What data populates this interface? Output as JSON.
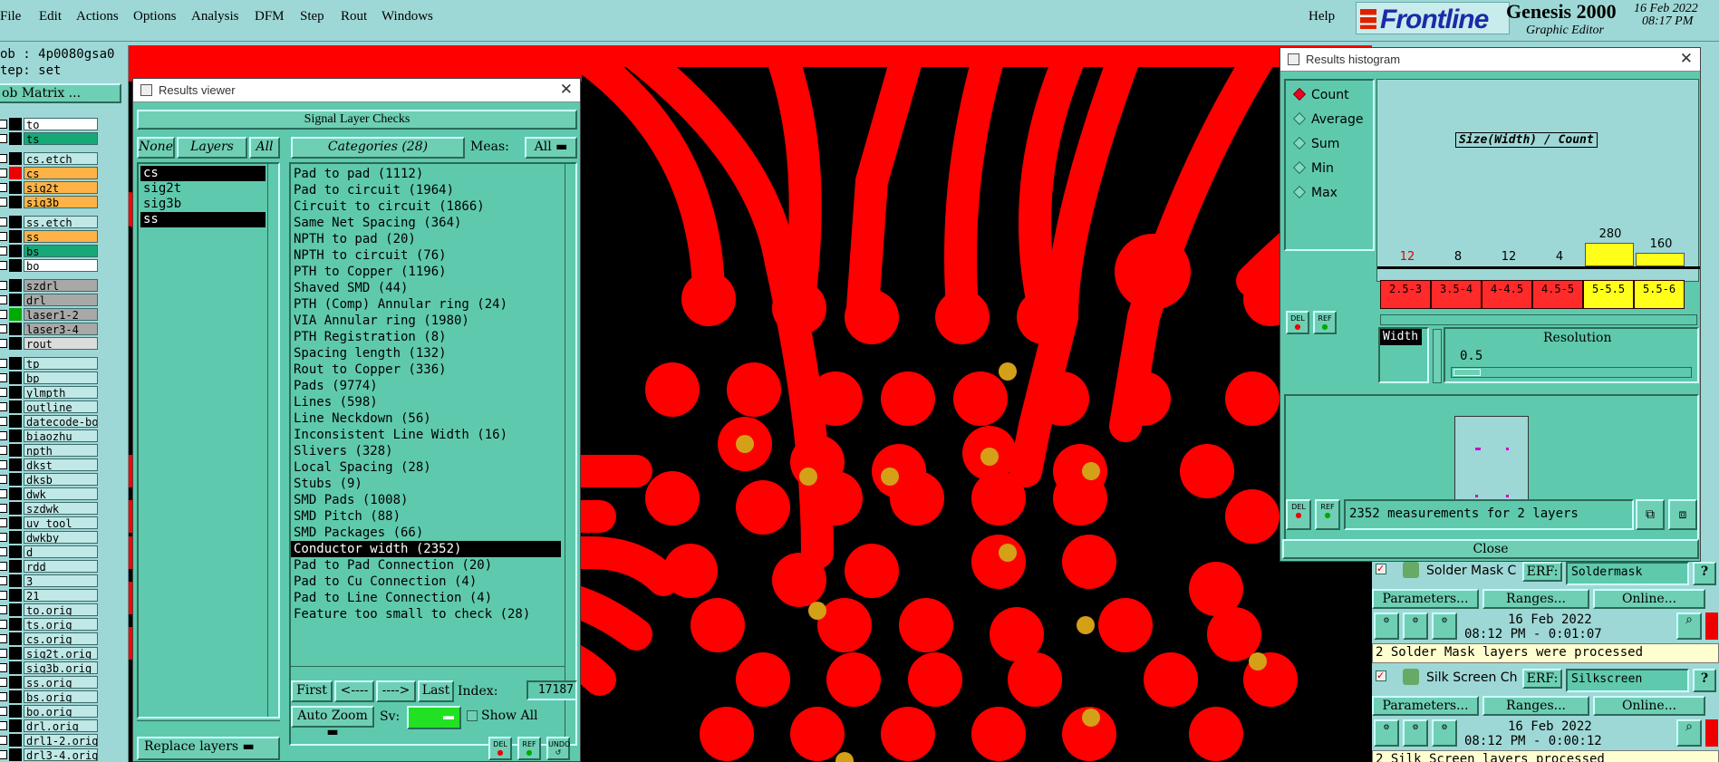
{
  "app": {
    "product": "Genesis 2000",
    "subtitle": "Graphic Editor",
    "brand": "Frontline",
    "date": "16 Feb 2022",
    "time": "08:17 PM"
  },
  "menu": {
    "items": [
      "File",
      "Edit",
      "Actions",
      "Options",
      "Analysis",
      "DFM",
      "Step",
      "Rout",
      "Windows"
    ],
    "help": "Help"
  },
  "job": {
    "job_label": "ob : 4p0080gsa0",
    "step_label": "tep: set",
    "matrix_button": "ob Matrix ..."
  },
  "layers": [
    {
      "name": "to",
      "color": "#ffffff"
    },
    {
      "name": "ts",
      "color": "#18a878"
    },
    {
      "name": "cs.etch",
      "color": "#bfe8e6"
    },
    {
      "name": "cs",
      "color": "#ffb347"
    },
    {
      "name": "sig2t",
      "color": "#ffb347"
    },
    {
      "name": "sig3b",
      "color": "#ffb347"
    },
    {
      "name": "ss.etch",
      "color": "#bfe8e6"
    },
    {
      "name": "ss",
      "color": "#ffb347"
    },
    {
      "name": "bs",
      "color": "#18a878"
    },
    {
      "name": "bo",
      "color": "#ffffff"
    },
    {
      "name": "szdrl",
      "color": "#a8a8a8"
    },
    {
      "name": "drl",
      "color": "#a8a8a8"
    },
    {
      "name": "laser1-2",
      "color": "#a8a8a8"
    },
    {
      "name": "laser3-4",
      "color": "#a8a8a8"
    },
    {
      "name": "rout",
      "color": "#dcdcdc"
    },
    {
      "name": "tp",
      "color": "#bfe8e6"
    },
    {
      "name": "bp",
      "color": "#bfe8e6"
    },
    {
      "name": "ylmpth",
      "color": "#bfe8e6"
    },
    {
      "name": "outline",
      "color": "#bfe8e6"
    },
    {
      "name": "datecode-bo",
      "color": "#bfe8e6"
    },
    {
      "name": "biaozhu",
      "color": "#bfe8e6"
    },
    {
      "name": "npth",
      "color": "#bfe8e6"
    },
    {
      "name": "dkst",
      "color": "#bfe8e6"
    },
    {
      "name": "dksb",
      "color": "#bfe8e6"
    },
    {
      "name": "dwk",
      "color": "#bfe8e6"
    },
    {
      "name": "szdwk",
      "color": "#bfe8e6"
    },
    {
      "name": "uv_tool",
      "color": "#bfe8e6"
    },
    {
      "name": "dwkby",
      "color": "#bfe8e6"
    },
    {
      "name": "d",
      "color": "#bfe8e6"
    },
    {
      "name": "rdd",
      "color": "#bfe8e6"
    },
    {
      "name": "3",
      "color": "#bfe8e6"
    },
    {
      "name": "21",
      "color": "#bfe8e6"
    },
    {
      "name": "to.orig",
      "color": "#bfe8e6"
    },
    {
      "name": "ts.orig",
      "color": "#bfe8e6"
    },
    {
      "name": "cs.orig",
      "color": "#bfe8e6"
    },
    {
      "name": "sig2t.orig",
      "color": "#bfe8e6"
    },
    {
      "name": "sig3b.orig",
      "color": "#bfe8e6"
    },
    {
      "name": "ss.orig",
      "color": "#bfe8e6"
    },
    {
      "name": "bs.orig",
      "color": "#bfe8e6"
    },
    {
      "name": "bo.orig",
      "color": "#bfe8e6"
    },
    {
      "name": "drl.orig",
      "color": "#bfe8e6"
    },
    {
      "name": "drl1-2.orig",
      "color": "#bfe8e6"
    },
    {
      "name": "drl3-4.orig",
      "color": "#bfe8e6"
    }
  ],
  "results_viewer": {
    "title": "Results viewer",
    "header": "Signal Layer Checks",
    "none_button": "None",
    "layers_button": "Layers",
    "all_button": "All",
    "categories_button": "Categories (28)",
    "meas_label": "Meas:",
    "meas_value": "All",
    "layer_list": [
      "cs",
      "sig2t",
      "sig3b",
      "ss"
    ],
    "selected_layers": [
      "cs",
      "ss"
    ],
    "categories": [
      "Pad to pad (1112)",
      "Pad to circuit (1964)",
      "Circuit to circuit (1866)",
      "Same Net Spacing (364)",
      "NPTH to pad (20)",
      "NPTH to circuit (76)",
      "PTH to Copper (1196)",
      "Shaved SMD (44)",
      "PTH (Comp) Annular ring (24)",
      "VIA Annular ring (1980)",
      "PTH Registration (8)",
      "Spacing length (132)",
      "Rout to Copper (336)",
      "Pads (9774)",
      "Lines (598)",
      "Line Neckdown (56)",
      "Inconsistent Line Width (16)",
      "Slivers (328)",
      "Local Spacing (28)",
      "Stubs (9)",
      "SMD Pads (1008)",
      "SMD Pitch (88)",
      "SMD Packages (66)",
      "Conductor width (2352)",
      "Pad to Pad Connection (20)",
      "Pad to Cu Connection (4)",
      "Pad to Line Connection (4)",
      "Feature too small to check (28)"
    ],
    "selected_category": "Conductor width (2352)",
    "first_button": "First",
    "prev_button": "<----",
    "next_button": "---->",
    "last_button": "Last",
    "index_label": "Index:",
    "index_value": "17187",
    "auto_zoom_button": "Auto Zoom",
    "sv_label": "Sv:",
    "show_all_label": "Show All",
    "replace_layers_button": "Replace layers",
    "del_label": "DEL",
    "ref_label": "REF",
    "undo_label": "UNDO"
  },
  "histogram": {
    "title": "Results histogram",
    "modes": [
      "Count",
      "Average",
      "Sum",
      "Min",
      "Max"
    ],
    "selected_mode": "Count",
    "chart_title": "Size(Width) / Count",
    "bins": [
      {
        "range": "2.5-3",
        "count": 12,
        "color": "#ff2a2a",
        "countColor": "#e00000"
      },
      {
        "range": "3.5-4",
        "count": 8,
        "color": "#ff2a2a",
        "countColor": "#000000"
      },
      {
        "range": "4-4.5",
        "count": 12,
        "color": "#ff2a2a",
        "countColor": "#000000"
      },
      {
        "range": "4.5-5",
        "count": 4,
        "color": "#ff2a2a",
        "countColor": "#000000"
      },
      {
        "range": "5-5.5",
        "count": 280,
        "color": "#ffff1a",
        "countColor": "#000000"
      },
      {
        "range": "5.5-6",
        "count": 160,
        "color": "#ffff1a",
        "countColor": "#000000"
      }
    ],
    "field_label": "Width",
    "resolution_label": "Resolution",
    "resolution_value": "0.5",
    "status": "2352 measurements for 2 layers",
    "close_button": "Close",
    "del_label": "DEL",
    "ref_label": "REF"
  },
  "checks": [
    {
      "name": "Solder Mask Ch",
      "erf_label": "ERF:",
      "erf_value": "Soldermask",
      "help": "?",
      "parameters_button": "Parameters...",
      "ranges_button": "Ranges...",
      "online_button": "Online...",
      "date": "16 Feb 2022",
      "time": "08:12 PM - 0:01:07",
      "status": "2 Solder Mask layers were processed"
    },
    {
      "name": "Silk Screen Che",
      "erf_label": "ERF:",
      "erf_value": "Silkscreen",
      "help": "?",
      "parameters_button": "Parameters...",
      "ranges_button": "Ranges...",
      "online_button": "Online...",
      "date": "16 Feb 2022",
      "time": "08:12 PM - 0:00:12",
      "status": "2 Silk Screen layers processed"
    }
  ],
  "colors": {
    "dialog_bg": "#5fc9ad",
    "window_bg": "#9ed8d6",
    "copper": "#ff0000",
    "drill": "#d4a017"
  }
}
